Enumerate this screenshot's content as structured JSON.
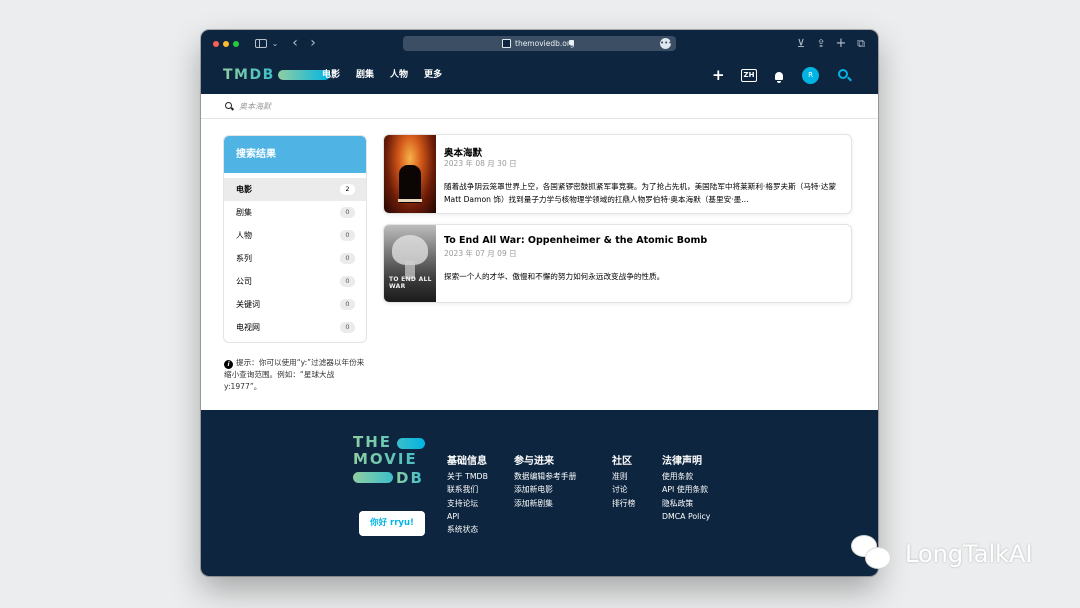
{
  "browser": {
    "url": "themoviedb.org",
    "icons": [
      "sidebar-icon",
      "chevron-down-icon",
      "back-icon",
      "forward-icon",
      "lock-icon",
      "more-icon",
      "download-icon",
      "share-icon",
      "plus-icon",
      "tabs-icon"
    ]
  },
  "header": {
    "logo": "TMDB",
    "nav": [
      "电影",
      "剧集",
      "人物",
      "更多"
    ],
    "lang": "ZH",
    "avatar_initial": "R"
  },
  "search": {
    "placeholder": "奥本海默"
  },
  "sidebar": {
    "title": "搜索结果",
    "items": [
      {
        "label": "电影",
        "count": "2"
      },
      {
        "label": "剧集",
        "count": "0"
      },
      {
        "label": "人物",
        "count": "0"
      },
      {
        "label": "系列",
        "count": "0"
      },
      {
        "label": "公司",
        "count": "0"
      },
      {
        "label": "关键词",
        "count": "0"
      },
      {
        "label": "电视网",
        "count": "0"
      }
    ],
    "tip": "提示：你可以使用“y:”过滤器以年份来缩小查询范围。例如：“星球大战 y:1977”。"
  },
  "results": [
    {
      "title": "奥本海默",
      "date": "2023 年 08 月 30 日",
      "overview": "随着战争阴云笼罩世界上空，各国紧锣密鼓抓紧军事竞赛。为了抢占先机，美国陆军中将莱斯利·格罗夫斯（马特·达蒙 Matt Damon 饰）找到量子力学与核物理学领域的扛鼎人物罗伯特·奥本海默（基里安·墨…"
    },
    {
      "title": "To End All War: Oppenheimer & the Atomic Bomb",
      "date": "2023 年 07 月 09 日",
      "overview": "探索一个人的才华、傲慢和不懈的努力如何永远改变战争的性质。",
      "poster_text": "TO END ALL WAR"
    }
  ],
  "footer": {
    "logo_lines": [
      "THE",
      "MOVIE",
      "DB"
    ],
    "cta": "你好 rryu!",
    "columns": [
      {
        "title": "基础信息",
        "links": [
          "关于 TMDB",
          "联系我们",
          "支持论坛",
          "API",
          "系统状态"
        ]
      },
      {
        "title": "参与进来",
        "links": [
          "数据编辑参考手册",
          "添加新电影",
          "添加新剧集"
        ]
      },
      {
        "title": "社区",
        "links": [
          "准则",
          "讨论",
          "排行榜"
        ]
      },
      {
        "title": "法律声明",
        "links": [
          "使用条款",
          "API 使用条款",
          "隐私政策",
          "DMCA Policy"
        ]
      }
    ]
  },
  "watermark": "LongTalkAI",
  "colors": {
    "navy": "#0d253f",
    "accent": "#01b4e4",
    "green": "#90cea1"
  }
}
